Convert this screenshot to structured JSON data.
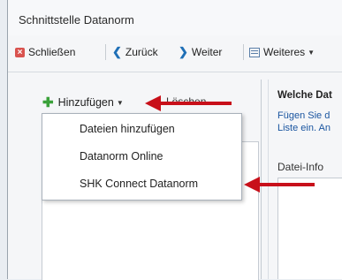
{
  "window": {
    "title": "Schnittstelle Datanorm"
  },
  "toolbar": {
    "close_label": "Schließen",
    "back_label": "Zurück",
    "forward_label": "Weiter",
    "more_label": "Weiteres"
  },
  "left_panel": {
    "add_label": "Hinzufügen",
    "delete_label": "Löschen"
  },
  "add_menu": {
    "items": [
      {
        "label": "Dateien hinzufügen"
      },
      {
        "label": "Datanorm Online"
      },
      {
        "label": "SHK Connect Datanorm"
      }
    ]
  },
  "right_panel": {
    "heading": "Welche Dat",
    "text_line1": "Fügen Sie d",
    "text_line2": "Liste ein. An",
    "file_info_label": "Datei-Info"
  },
  "colors": {
    "arrow": "#c8101a",
    "link_text": "#1a55a0",
    "plus_icon": "#3aa13a",
    "close_icon": "#d9534f"
  }
}
